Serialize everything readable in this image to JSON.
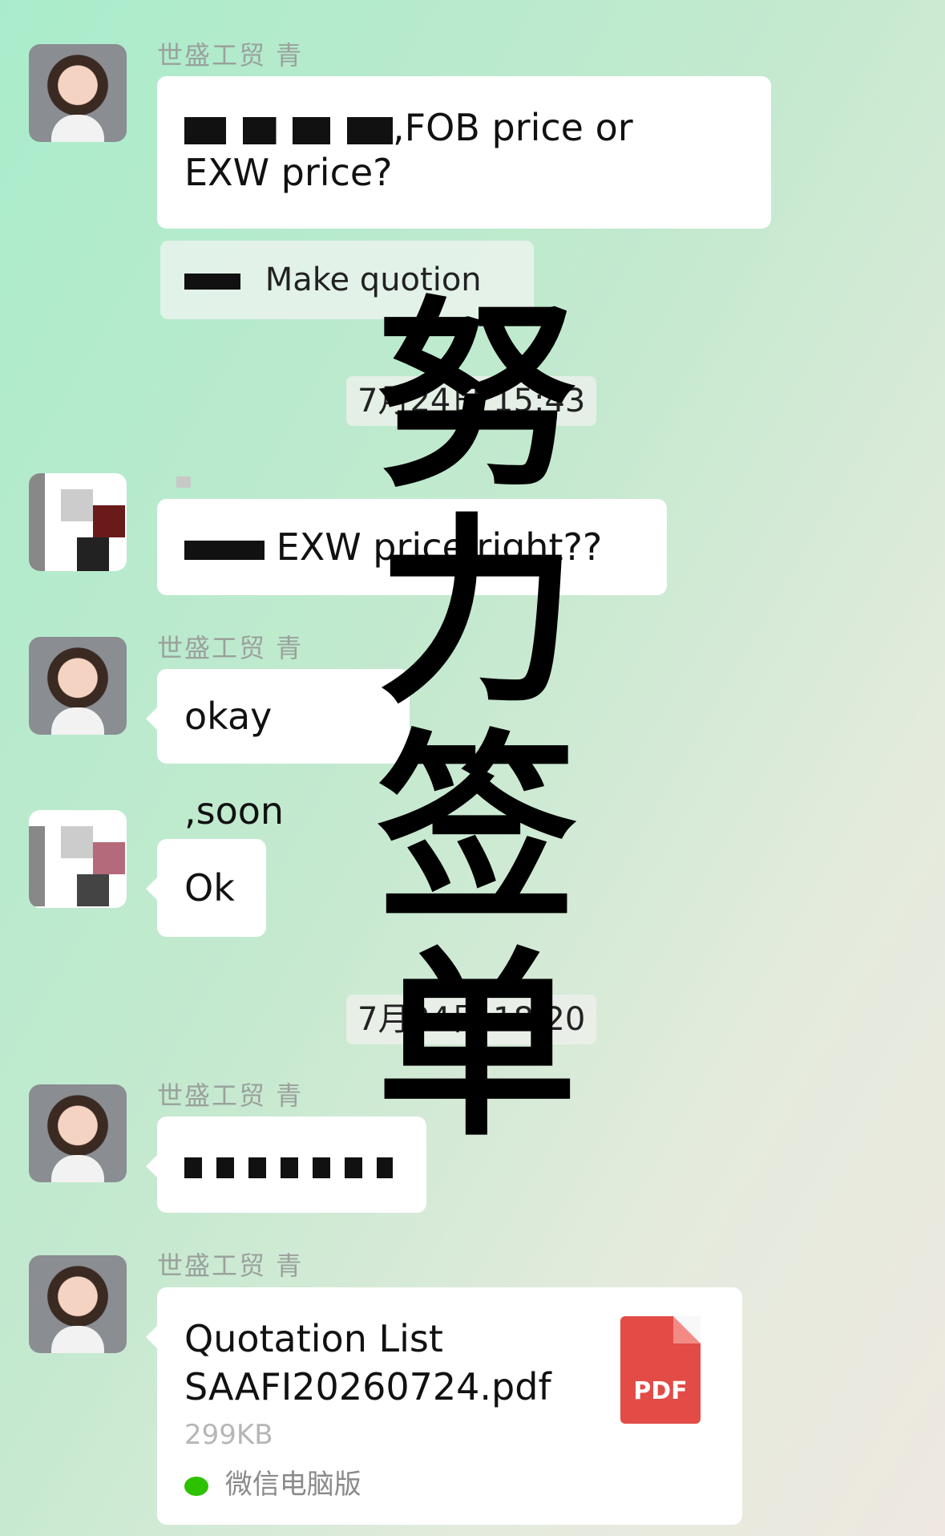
{
  "sender_name": "世盛工贸 青",
  "messages": {
    "m1_line1_tail": ",FOB price or",
    "m1_line2": "EXW price?",
    "quote_text": "Make quotion",
    "time1": "7月24日 15:43",
    "m2_text": "EXW price right??",
    "m3_text": "okay ,soon",
    "m4_text": "Ok",
    "time2": "7月24日 18:20"
  },
  "file_card": {
    "title_line1": "Quotation List",
    "title_line2": "SAAFI20260724.pdf",
    "size": "299KB",
    "icon_label": "PDF",
    "source_app": "微信电脑版"
  },
  "overlay": {
    "chars": [
      "努",
      "力",
      "签",
      "单"
    ]
  },
  "colors": {
    "bubble_bg": "#ffffff",
    "name_gray": "#9aa19c",
    "pdf_red": "#e24b46",
    "wechat_green": "#2dc100"
  },
  "icons": {
    "file_icon": "pdf-file-icon",
    "source_icon": "wechat-icon"
  }
}
